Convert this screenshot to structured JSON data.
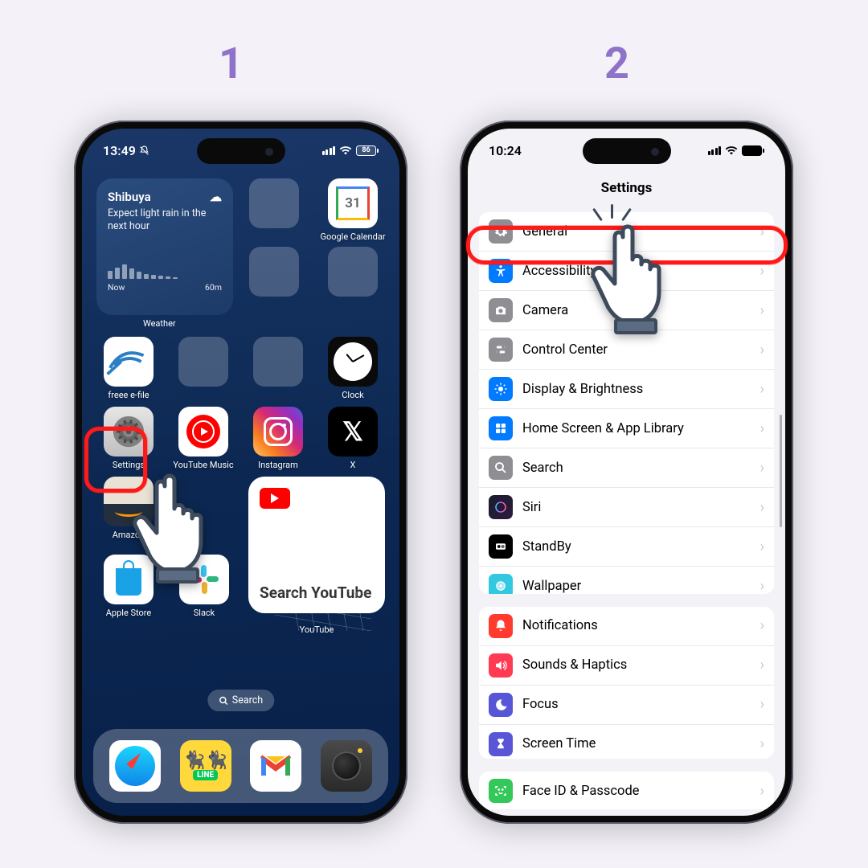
{
  "steps": {
    "one": "1",
    "two": "2"
  },
  "left": {
    "status": {
      "time": "13:49",
      "battery": "86"
    },
    "weather": {
      "location": "Shibuya",
      "condition": "Expect light rain in the next hour",
      "now_label": "Now",
      "range_label": "60m",
      "app_label": "Weather"
    },
    "apps": {
      "google_calendar": "Google Calendar",
      "gcal_day": "31",
      "clock": "Clock",
      "freee": "freee e-file",
      "settings": "Settings",
      "youtube_music": "YouTube Music",
      "instagram": "Instagram",
      "x": "X",
      "amazon": "Amazon",
      "apple_store": "Apple Store",
      "slack": "Slack",
      "youtube": "YouTube"
    },
    "youtube_widget": "Search YouTube",
    "search_pill": "Search"
  },
  "right": {
    "status": {
      "time": "10:24"
    },
    "title": "Settings",
    "items1": [
      {
        "label": "General"
      },
      {
        "label": "Accessibility"
      },
      {
        "label": "Camera"
      },
      {
        "label": "Control Center"
      },
      {
        "label": "Display & Brightness"
      },
      {
        "label": "Home Screen & App Library"
      },
      {
        "label": "Search"
      },
      {
        "label": "Siri"
      },
      {
        "label": "StandBy"
      },
      {
        "label": "Wallpaper"
      }
    ],
    "items2": [
      {
        "label": "Notifications"
      },
      {
        "label": "Sounds & Haptics"
      },
      {
        "label": "Focus"
      },
      {
        "label": "Screen Time"
      }
    ],
    "items3": [
      {
        "label": "Face ID & Passcode"
      }
    ]
  }
}
